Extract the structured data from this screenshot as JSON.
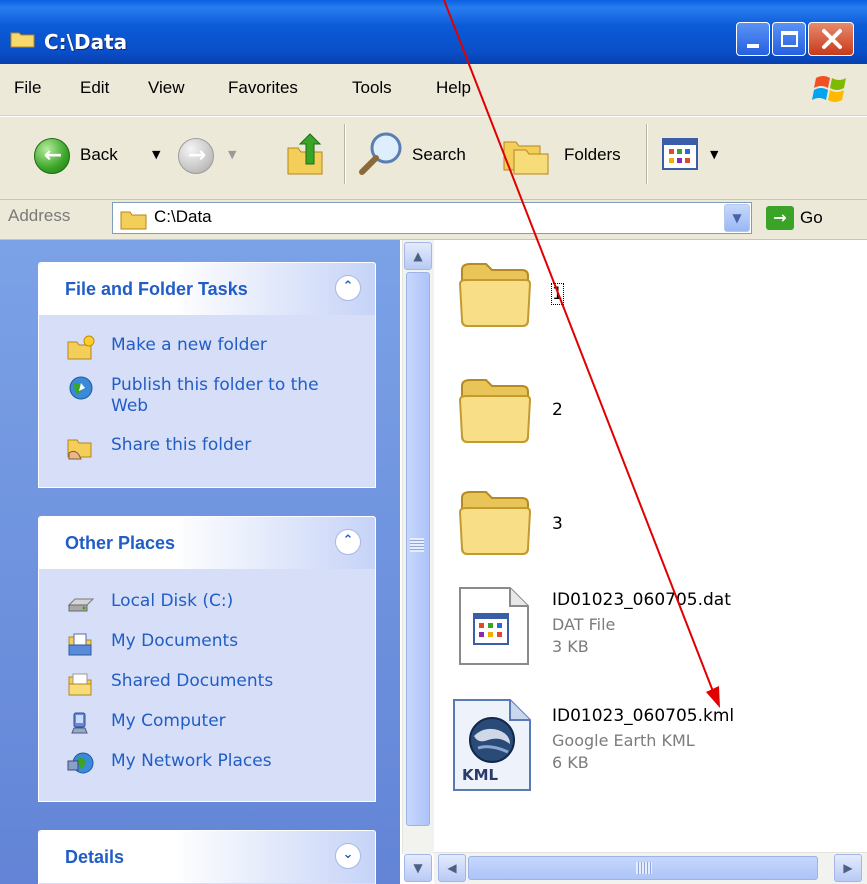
{
  "window": {
    "title": "C:\\Data"
  },
  "menu": [
    "File",
    "Edit",
    "View",
    "Favorites",
    "Tools",
    "Help"
  ],
  "toolbar": {
    "back": "Back",
    "search": "Search",
    "folders": "Folders"
  },
  "address": {
    "label": "Address",
    "value": "C:\\Data",
    "go": "Go"
  },
  "tasks_panel": {
    "title": "File and Folder Tasks",
    "items": [
      "Make a new folder",
      "Publish this folder to the Web",
      "Share this folder"
    ]
  },
  "places_panel": {
    "title": "Other Places",
    "items": [
      "Local Disk (C:)",
      "My Documents",
      "Shared Documents",
      "My Computer",
      "My Network Places"
    ]
  },
  "details_panel": {
    "title": "Details"
  },
  "files": [
    {
      "name": "1",
      "type": "folder"
    },
    {
      "name": "2",
      "type": "folder"
    },
    {
      "name": "3",
      "type": "folder"
    },
    {
      "name": "ID01023_060705.dat",
      "kind": "DAT File",
      "size": "3 KB"
    },
    {
      "name": "ID01023_060705.kml",
      "kind": "Google Earth KML",
      "size": "6 KB",
      "badge": "KML"
    }
  ],
  "colors": {
    "accent": "#215dc6",
    "annotation": "#e00000",
    "titlebar": "#0a5fe0"
  }
}
